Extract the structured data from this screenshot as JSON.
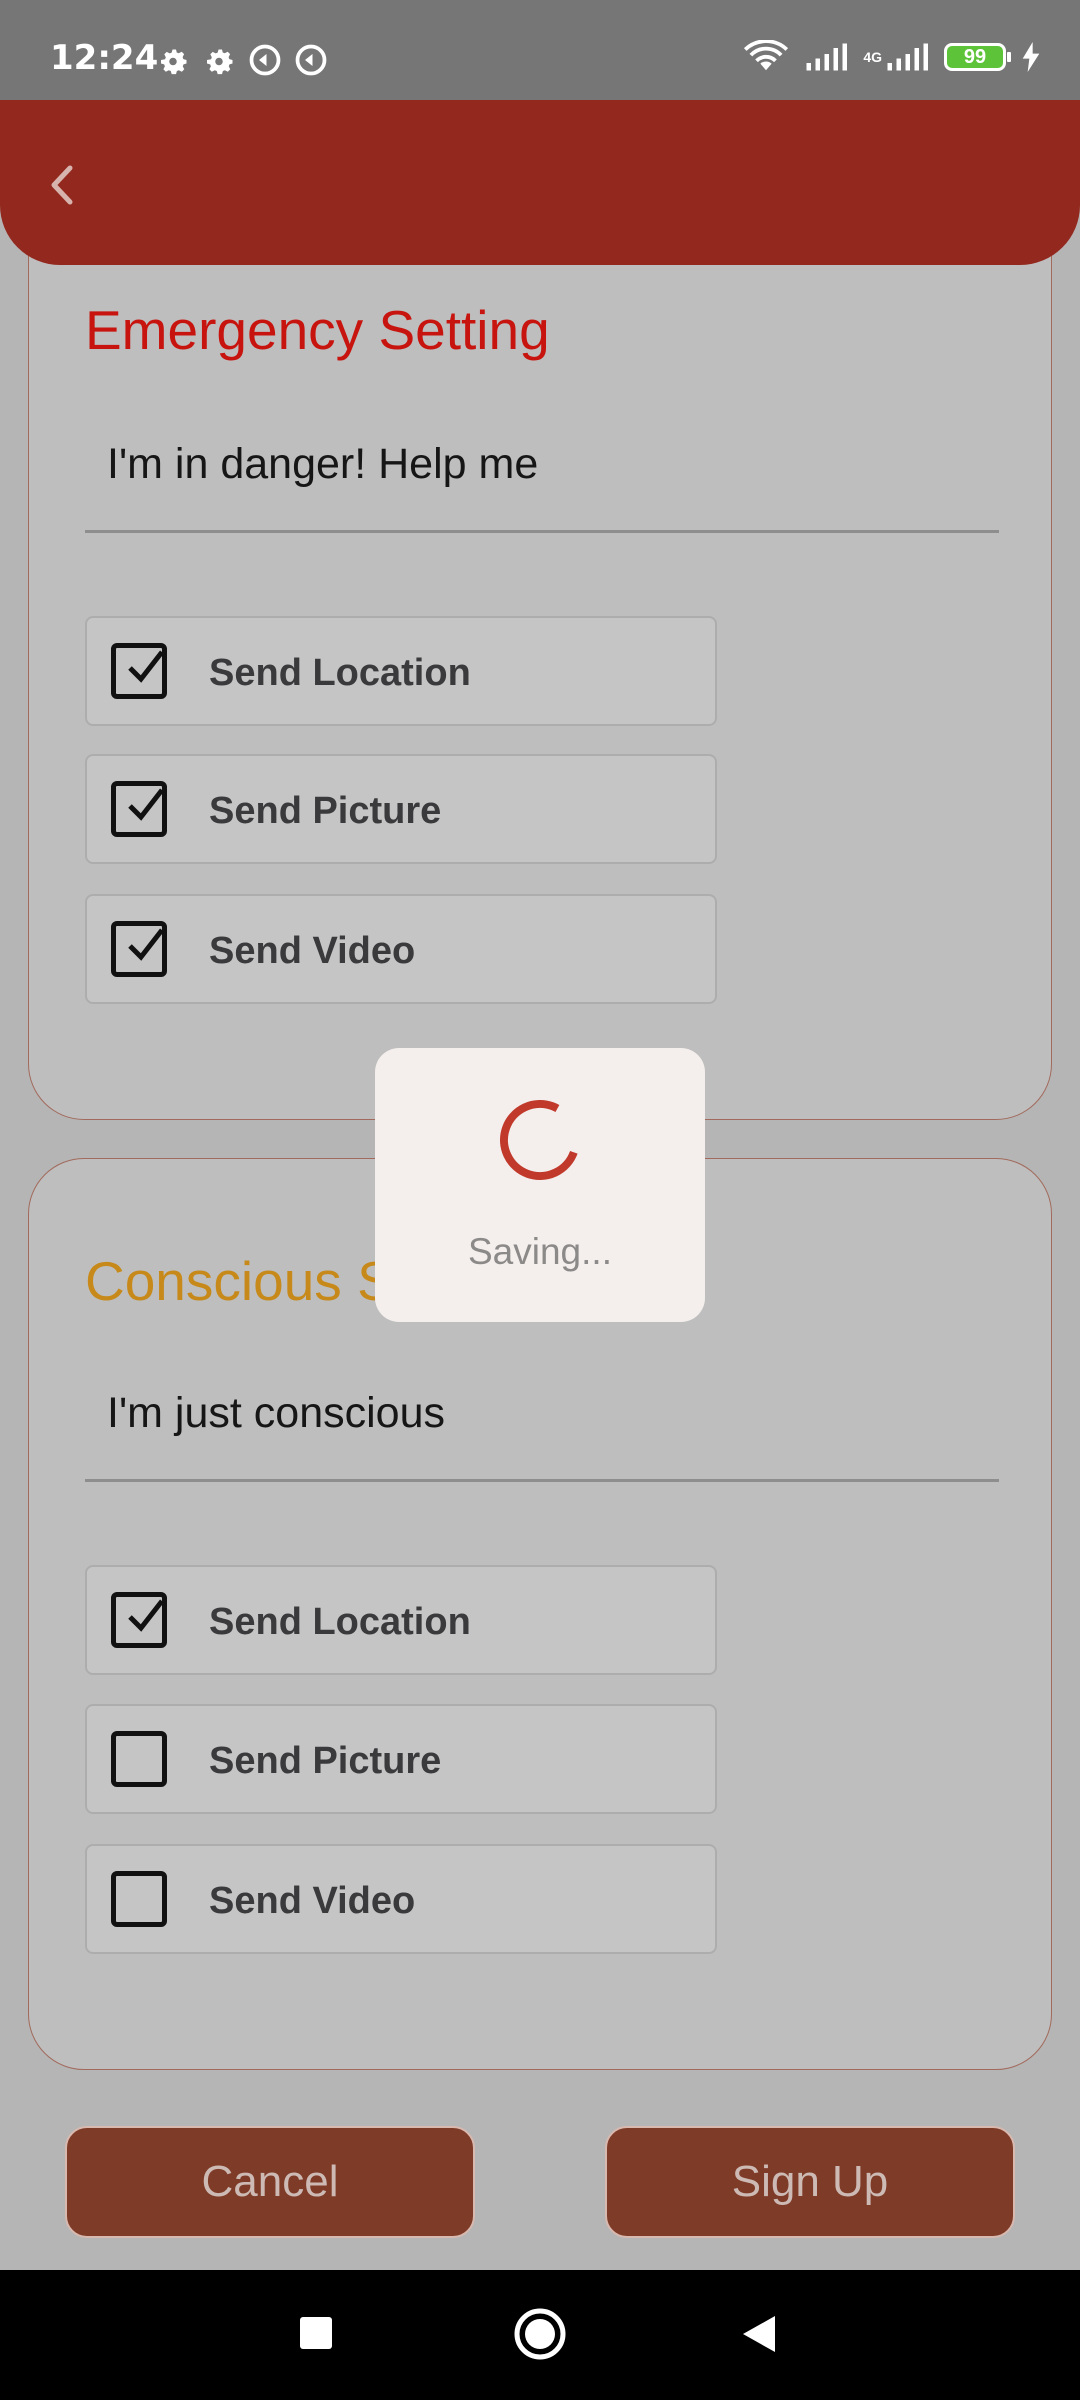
{
  "status_bar": {
    "time": "12:24",
    "battery": "99",
    "network": "4G"
  },
  "app_bar": {
    "back_icon": "chevron-left-icon"
  },
  "emergency": {
    "title": "Emergency Setting",
    "message": "I'm in danger! Help me",
    "title_color": "#c8140e",
    "options": [
      {
        "label": "Send Location",
        "checked": true
      },
      {
        "label": "Send Picture",
        "checked": true
      },
      {
        "label": "Send Video",
        "checked": true
      }
    ]
  },
  "conscious": {
    "title": "Conscious S",
    "message": "I'm just conscious",
    "title_color": "#c78a1a",
    "options": [
      {
        "label": "Send Location",
        "checked": true
      },
      {
        "label": "Send Picture",
        "checked": false
      },
      {
        "label": "Send Video",
        "checked": false
      }
    ]
  },
  "buttons": {
    "cancel": "Cancel",
    "sign_up": "Sign Up"
  },
  "dialog": {
    "text": "Saving..."
  },
  "colors": {
    "app_bar": "#93281e",
    "button": "#7e3b27",
    "spinner": "#c0392b"
  }
}
